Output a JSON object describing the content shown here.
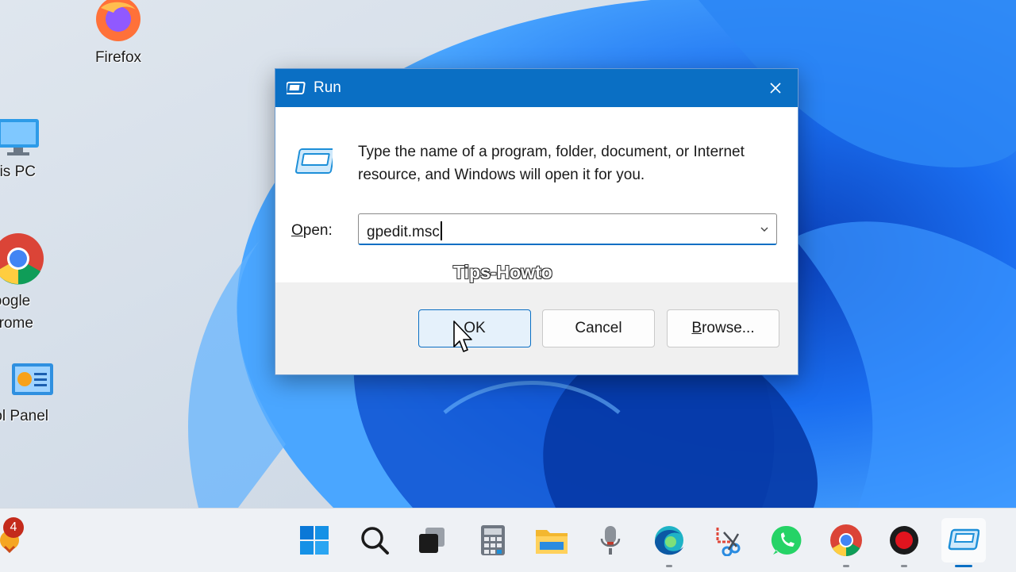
{
  "desktop": {
    "icons": [
      {
        "label": "Firefox"
      },
      {
        "label": "his PC"
      },
      {
        "label": "oogle\nhrome"
      },
      {
        "label": "rol Panel"
      }
    ]
  },
  "run_dialog": {
    "title": "Run",
    "description": "Type the name of a program, folder, document, or Internet resource, and Windows will open it for you.",
    "open_label_prefix": "O",
    "open_label_rest": "pen:",
    "open_value": "gpedit.msc",
    "buttons": {
      "ok": "OK",
      "cancel": "Cancel",
      "browse_underlined": "B",
      "browse_rest": "rowse..."
    }
  },
  "watermark": "Tips-Howto",
  "taskbar": {
    "notification_badge": "4",
    "items": [
      "start-icon",
      "search-icon",
      "task-view-icon",
      "calculator-icon",
      "file-explorer-icon",
      "recorder-icon",
      "edge-icon",
      "snipping-tool-icon",
      "whatsapp-icon",
      "chrome-icon",
      "record-icon",
      "run-icon"
    ]
  },
  "colors": {
    "accent": "#0a6fc4",
    "titlebar": "#0a6fc4",
    "desktop_bg": "#d9e2ec"
  }
}
